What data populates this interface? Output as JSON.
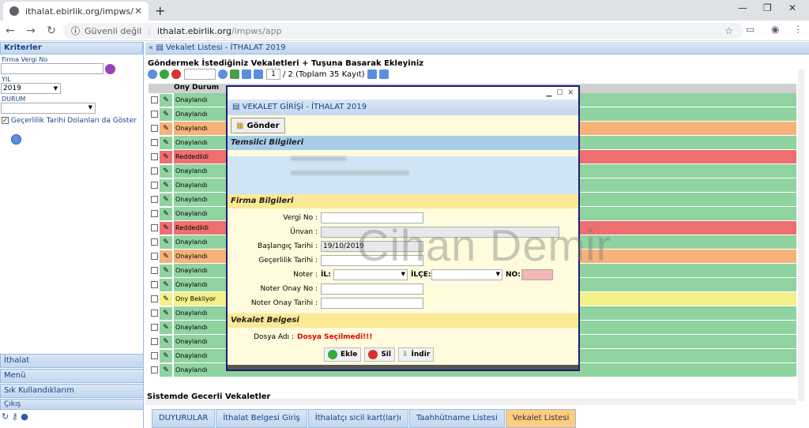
{
  "browser": {
    "tab_title": "ithalat.ebirlik.org/impws/app",
    "security": "Güvenli değil",
    "url_host": "ithalat.ebirlik.org",
    "url_path": "/impws/app"
  },
  "left": {
    "header": "Kriterler",
    "firma_label": "Firma Vergi No",
    "yil_label": "YIL",
    "yil_value": "2019",
    "durum_label": "DURUM",
    "checkbox_label": "Geçerlilik Tarihi Dolanları da Göster",
    "accordion": [
      "İthalat",
      "Menü",
      "Sık Kullandıklarım",
      "Çıkış"
    ]
  },
  "main": {
    "header": "Vekalet Listesi - İTHALAT 2019",
    "title": "Göndermek İstediğiniz Vekaletleri + Tuşuna Basarak Ekleyiniz",
    "page_value": "1",
    "page_info": "/ 2 (Toplam 35 Kayıt)",
    "col_status": "Ony Durum",
    "col_durum_tail": "urum",
    "rows": [
      {
        "status": "Onaylandı",
        "color": "#8fd3a0"
      },
      {
        "status": "Onaylandı",
        "color": "#8fd3a0"
      },
      {
        "status": "Onaylandı",
        "color": "#f6b27a"
      },
      {
        "status": "Onaylandı",
        "color": "#8fd3a0"
      },
      {
        "status": "Reddedildi",
        "color": "#ee6f6f"
      },
      {
        "status": "Onaylandı",
        "color": "#8fd3a0"
      },
      {
        "status": "Onaylandı",
        "color": "#8fd3a0"
      },
      {
        "status": "Onaylandı",
        "color": "#8fd3a0"
      },
      {
        "status": "Onaylandı",
        "color": "#8fd3a0"
      },
      {
        "status": "Reddedildi",
        "color": "#ee6f6f"
      },
      {
        "status": "Onaylandı",
        "color": "#8fd3a0"
      },
      {
        "status": "Onaylandı",
        "color": "#f6b27a"
      },
      {
        "status": "Onaylandı",
        "color": "#8fd3a0"
      },
      {
        "status": "Onaylandı",
        "color": "#8fd3a0"
      },
      {
        "status": "Ony Bekliyor",
        "color": "#f5f08a"
      },
      {
        "status": "Onaylandı",
        "color": "#8fd3a0"
      },
      {
        "status": "Onaylandı",
        "color": "#8fd3a0"
      },
      {
        "status": "Onaylandı",
        "color": "#8fd3a0"
      },
      {
        "status": "Onaylandı",
        "color": "#8fd3a0"
      },
      {
        "status": "Onaylandı",
        "color": "#8fd3a0"
      }
    ],
    "bottom_title": "Sistemde Geçerli Vekaletler",
    "tabs": [
      "DUYURULAR",
      "İthalat Belgesi Giriş",
      "İthalatçı sicil kart(lar)ı",
      "Taahhütname Listesi",
      "Vekalet Listesi"
    ]
  },
  "modal": {
    "title": "VEKALET GİRİŞİ - İTHALAT 2019",
    "send_label": "Gönder",
    "sec_temsilci": "Temsilci Bilgileri",
    "sec_firma": "Firma Bilgileri",
    "vergi_label": "Vergi No :",
    "unvan_label": "Ünvan :",
    "baslangic_label": "Başlangıç Tarihi :",
    "baslangic_value": "19/10/2019",
    "gecerlilik_label": "Geçerlilik Tarihi :",
    "noter_label": "Noter :",
    "il_label": "İL:",
    "ilce_label": "İLÇE:",
    "no_label": "NO:",
    "noter_onay_no_label": "Noter Onay No :",
    "noter_onay_tarihi_label": "Noter Onay Tarihi :",
    "sec_belge": "Vekalet Belgesi",
    "dosya_label": "Dosya Adı :",
    "dosya_value": "Dosya Seçilmedi!!!",
    "ekle": "Ekle",
    "sil": "Sil",
    "indir": "İndir"
  },
  "watermark": "Cihan Demir"
}
